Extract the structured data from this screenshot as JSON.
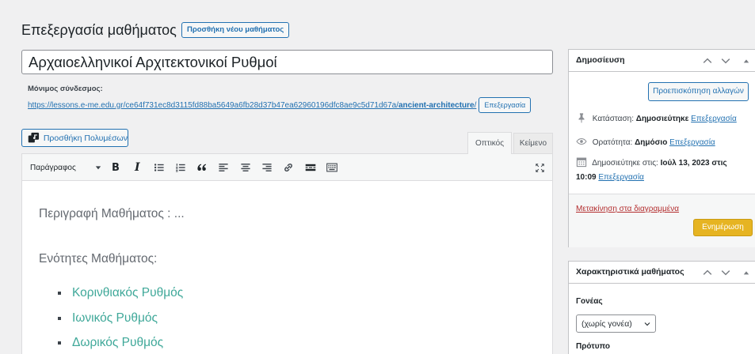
{
  "page": {
    "heading": "Επεξεργασία μαθήματος",
    "add_new_label": "Προσθήκη νέου μαθήματος"
  },
  "post": {
    "title": "Αρχαιοελληνικοί Αρχιτεκτονικοί Ρυθμοί",
    "permalink": {
      "label": "Μόνιμος σύνδεσμος:",
      "url_prefix": "https://lessons.e-me.edu.gr/ce64f731ec8d3115fd88ba5649a6fb28d37b47ea62960196dfc8ae9c5d71d67a/",
      "slug": "ancient-architecture",
      "url_suffix": "/",
      "edit_label": "Επεξεργασία"
    }
  },
  "editor": {
    "add_media_label": "Προσθήκη Πολυμέσων",
    "add_media_icon": "media-icon",
    "tabs": [
      {
        "label": "Οπτικός",
        "active": true
      },
      {
        "label": "Κείμενο",
        "active": false
      }
    ],
    "toolbar": {
      "format_select": "Παράγραφος",
      "buttons": [
        {
          "name": "bold-icon",
          "glyph": "B"
        },
        {
          "name": "italic-icon",
          "glyph": "I"
        },
        {
          "name": "bullet-list-icon"
        },
        {
          "name": "numbered-list-icon"
        },
        {
          "name": "blockquote-icon"
        },
        {
          "name": "align-left-icon"
        },
        {
          "name": "align-center-icon"
        },
        {
          "name": "align-right-icon"
        },
        {
          "name": "link-icon"
        },
        {
          "name": "read-more-icon"
        },
        {
          "name": "toolbar-toggle-icon"
        }
      ],
      "fullscreen_icon": "fullscreen-icon"
    },
    "content": {
      "paragraphs": [
        "Περιγραφή Μαθήματος : ...",
        "Ενότητες Μαθήματος:"
      ],
      "list_items": [
        "Κορινθιακός Ρυθμός",
        "Ιωνικός Ρυθμός",
        "Δωρικός Ρυθμός"
      ]
    }
  },
  "sidebar": {
    "publish": {
      "title": "Δημοσίευση",
      "header_icons": [
        "chevron-up-icon",
        "chevron-down-icon",
        "toggle-arrow-icon"
      ],
      "preview_label": "Προεπισκόπηση αλλαγών",
      "status": {
        "label": "Κατάσταση:",
        "value": "Δημοσιεύτηκε",
        "edit": "Επεξεργασία",
        "icon": "pin-icon"
      },
      "visibility": {
        "label": "Ορατότητα:",
        "value": "Δημόσιο",
        "edit": "Επεξεργασία",
        "icon": "eye-icon"
      },
      "published_on": {
        "label": "Δημοσιεύτηκε στις:",
        "value": "Ιούλ 13, 2023 στις 10:09",
        "edit": "Επεξεργασία",
        "icon": "calendar-icon"
      },
      "trash_label": "Μετακίνηση στα διαγραμμένα",
      "update_label": "Ενημέρωση"
    },
    "attributes": {
      "title": "Χαρακτηριστικά μαθήματος",
      "parent_label": "Γονέας",
      "parent_value": "(χωρίς γονέα)",
      "template_label": "Πρότυπο"
    }
  },
  "colors": {
    "accent": "#2271b1",
    "page_background": "#f0f0f1",
    "update_button": "#e6b422",
    "trash_link": "#b32d2e",
    "content_links": "#3fa899"
  }
}
